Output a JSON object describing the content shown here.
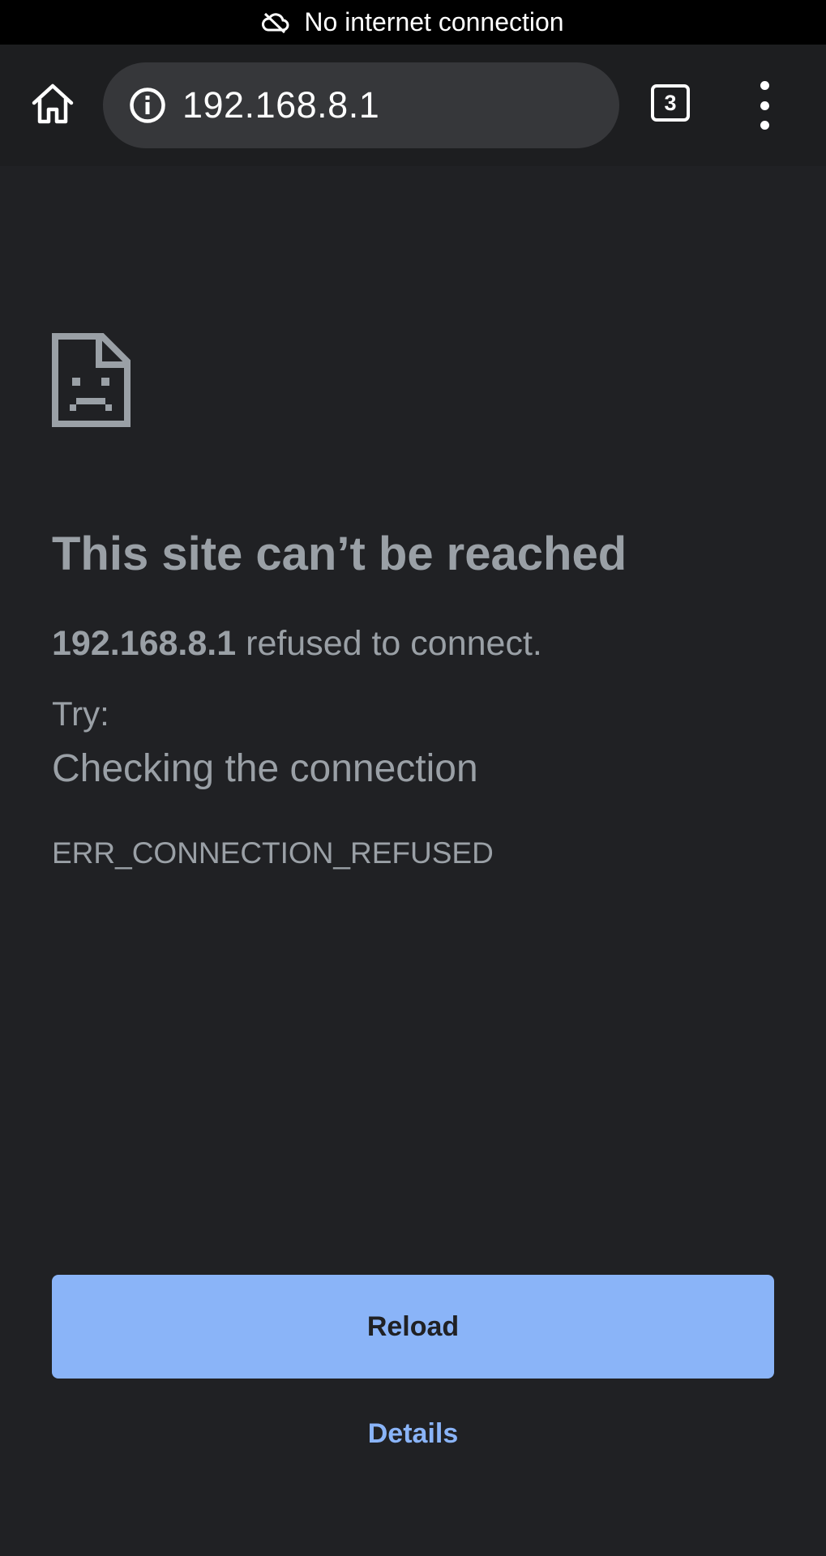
{
  "status_bar": {
    "text": "No internet connection",
    "icon": "cloud-off-icon"
  },
  "toolbar": {
    "home_icon": "home-icon",
    "info_icon": "info-icon",
    "url": "192.168.8.1",
    "tab_count": "3",
    "menu_icon": "more-vert-icon"
  },
  "error": {
    "icon": "sad-page-icon",
    "title": "This site can’t be reached",
    "host": "192.168.8.1",
    "refused_text": " refused to connect.",
    "try_label": "Try:",
    "suggestion": "Checking the connection",
    "code": "ERR_CONNECTION_REFUSED"
  },
  "actions": {
    "reload_label": "Reload",
    "details_label": "Details"
  },
  "colors": {
    "background": "#202124",
    "text": "#9aa0a6",
    "accent": "#8ab4f8",
    "omnibox": "#36373a"
  }
}
